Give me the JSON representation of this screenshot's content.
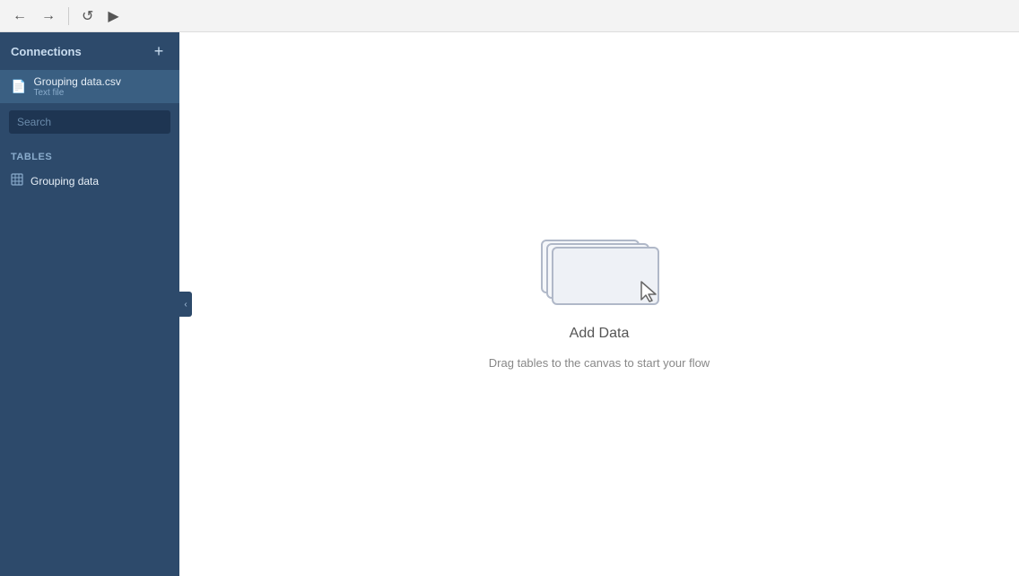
{
  "toolbar": {
    "back_label": "←",
    "forward_label": "→",
    "reload_label": "↺",
    "play_label": "▶"
  },
  "sidebar": {
    "connections_label": "Connections",
    "add_label": "+",
    "collapse_label": "‹",
    "file": {
      "name": "Grouping data.csv",
      "type": "Text file"
    },
    "search_placeholder": "Search",
    "tables_label": "Tables",
    "tables": [
      {
        "name": "Grouping data"
      }
    ]
  },
  "canvas": {
    "add_data_title": "Add Data",
    "add_data_subtitle": "Drag tables to the canvas to start your flow"
  }
}
